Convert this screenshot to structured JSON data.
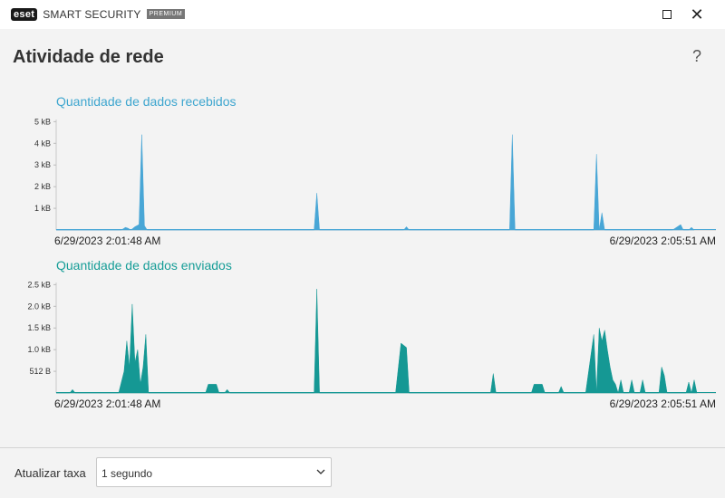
{
  "window": {
    "brand": "eset",
    "product": "SMART SECURITY",
    "edition": "PREMIUM",
    "maximize_icon": "maximize-icon",
    "close_icon": "close-icon",
    "close_glyph": "✕"
  },
  "page": {
    "title": "Atividade de rede",
    "help_glyph": "?"
  },
  "charts": {
    "received": {
      "title": "Quantidade de dados recebidos"
    },
    "sent": {
      "title": "Quantidade de dados enviados"
    }
  },
  "footer": {
    "refresh_label": "Atualizar taxa",
    "refresh_value": "1 segundo"
  },
  "colors": {
    "received": "#48a6d6",
    "sent": "#159894",
    "received_title": "#3ea6cf",
    "sent_title": "#169d97"
  },
  "chart_data": [
    {
      "type": "area",
      "title": "Quantidade de dados recebidos",
      "x_start_label": "6/29/2023 2:01:48 AM",
      "x_end_label": "6/29/2023 2:05:51 AM",
      "y_ticks": [
        1,
        2,
        3,
        4,
        5
      ],
      "y_tick_labels": [
        "1 kB",
        "2 kB",
        "3 kB",
        "4 kB",
        "5 kB"
      ],
      "ylim": [
        0,
        5.1
      ],
      "x_range": [
        0,
        243
      ],
      "series": [
        {
          "color": "#48a6d6",
          "points": [
            [
              0,
              0
            ],
            [
              24,
              0
            ],
            [
              25.5,
              0.12
            ],
            [
              26.5,
              0.08
            ],
            [
              27.5,
              0
            ],
            [
              29,
              0.15
            ],
            [
              30.5,
              0.25
            ],
            [
              31.5,
              4.4
            ],
            [
              32.5,
              0.2
            ],
            [
              33.5,
              0
            ],
            [
              95,
              0
            ],
            [
              96,
              1.7
            ],
            [
              97,
              0
            ],
            [
              128,
              0
            ],
            [
              129,
              0.15
            ],
            [
              130,
              0
            ],
            [
              167,
              0
            ],
            [
              168,
              4.4
            ],
            [
              169,
              0
            ],
            [
              198,
              0
            ],
            [
              199,
              3.5
            ],
            [
              200,
              0
            ],
            [
              201,
              0.8
            ],
            [
              202,
              0
            ],
            [
              227,
              0
            ],
            [
              230,
              0.25
            ],
            [
              231,
              0
            ],
            [
              233,
              0
            ],
            [
              234,
              0.12
            ],
            [
              235,
              0
            ]
          ]
        }
      ]
    },
    {
      "type": "area",
      "title": "Quantidade de dados enviados",
      "x_start_label": "6/29/2023 2:01:48 AM",
      "x_end_label": "6/29/2023 2:05:51 AM",
      "y_ticks": [
        0.5,
        1.0,
        1.5,
        2.0,
        2.5
      ],
      "y_tick_labels": [
        "512 B",
        "1.0 kB",
        "1.5 kB",
        "2.0 kB",
        "2.5 kB"
      ],
      "ylim": [
        0,
        2.55
      ],
      "x_range": [
        0,
        243
      ],
      "series": [
        {
          "color": "#159894",
          "points": [
            [
              0,
              0
            ],
            [
              5,
              0
            ],
            [
              6,
              0.08
            ],
            [
              7,
              0
            ],
            [
              23,
              0
            ],
            [
              25,
              0.5
            ],
            [
              26,
              1.2
            ],
            [
              27,
              0.6
            ],
            [
              28,
              2.05
            ],
            [
              29,
              0.7
            ],
            [
              30,
              1.0
            ],
            [
              31,
              0.2
            ],
            [
              32,
              0.6
            ],
            [
              33,
              1.35
            ],
            [
              34,
              0
            ],
            [
              55,
              0
            ],
            [
              56,
              0.2
            ],
            [
              59,
              0.2
            ],
            [
              60,
              0
            ],
            [
              62,
              0
            ],
            [
              63,
              0.08
            ],
            [
              64,
              0
            ],
            [
              95,
              0
            ],
            [
              96,
              2.4
            ],
            [
              97,
              0
            ],
            [
              125,
              0
            ],
            [
              127,
              1.15
            ],
            [
              128,
              1.1
            ],
            [
              129,
              1.05
            ],
            [
              130,
              0
            ],
            [
              160,
              0
            ],
            [
              161,
              0.45
            ],
            [
              162,
              0
            ],
            [
              175,
              0
            ],
            [
              176,
              0.2
            ],
            [
              179,
              0.2
            ],
            [
              180,
              0
            ],
            [
              185,
              0
            ],
            [
              186,
              0.15
            ],
            [
              187,
              0
            ],
            [
              195,
              0
            ],
            [
              198,
              1.35
            ],
            [
              199,
              0
            ],
            [
              200,
              1.5
            ],
            [
              201,
              1.2
            ],
            [
              202,
              1.45
            ],
            [
              203,
              1.0
            ],
            [
              204,
              0.6
            ],
            [
              205,
              0.3
            ],
            [
              206,
              0.2
            ],
            [
              207,
              0
            ],
            [
              208,
              0.3
            ],
            [
              209,
              0
            ],
            [
              211,
              0
            ],
            [
              212,
              0.3
            ],
            [
              213,
              0
            ],
            [
              215,
              0
            ],
            [
              216,
              0.3
            ],
            [
              217,
              0
            ],
            [
              222,
              0
            ],
            [
              223,
              0.6
            ],
            [
              224,
              0.4
            ],
            [
              225,
              0
            ],
            [
              232,
              0
            ],
            [
              233,
              0.25
            ],
            [
              234,
              0
            ],
            [
              235,
              0.3
            ],
            [
              236,
              0
            ]
          ]
        }
      ]
    }
  ]
}
